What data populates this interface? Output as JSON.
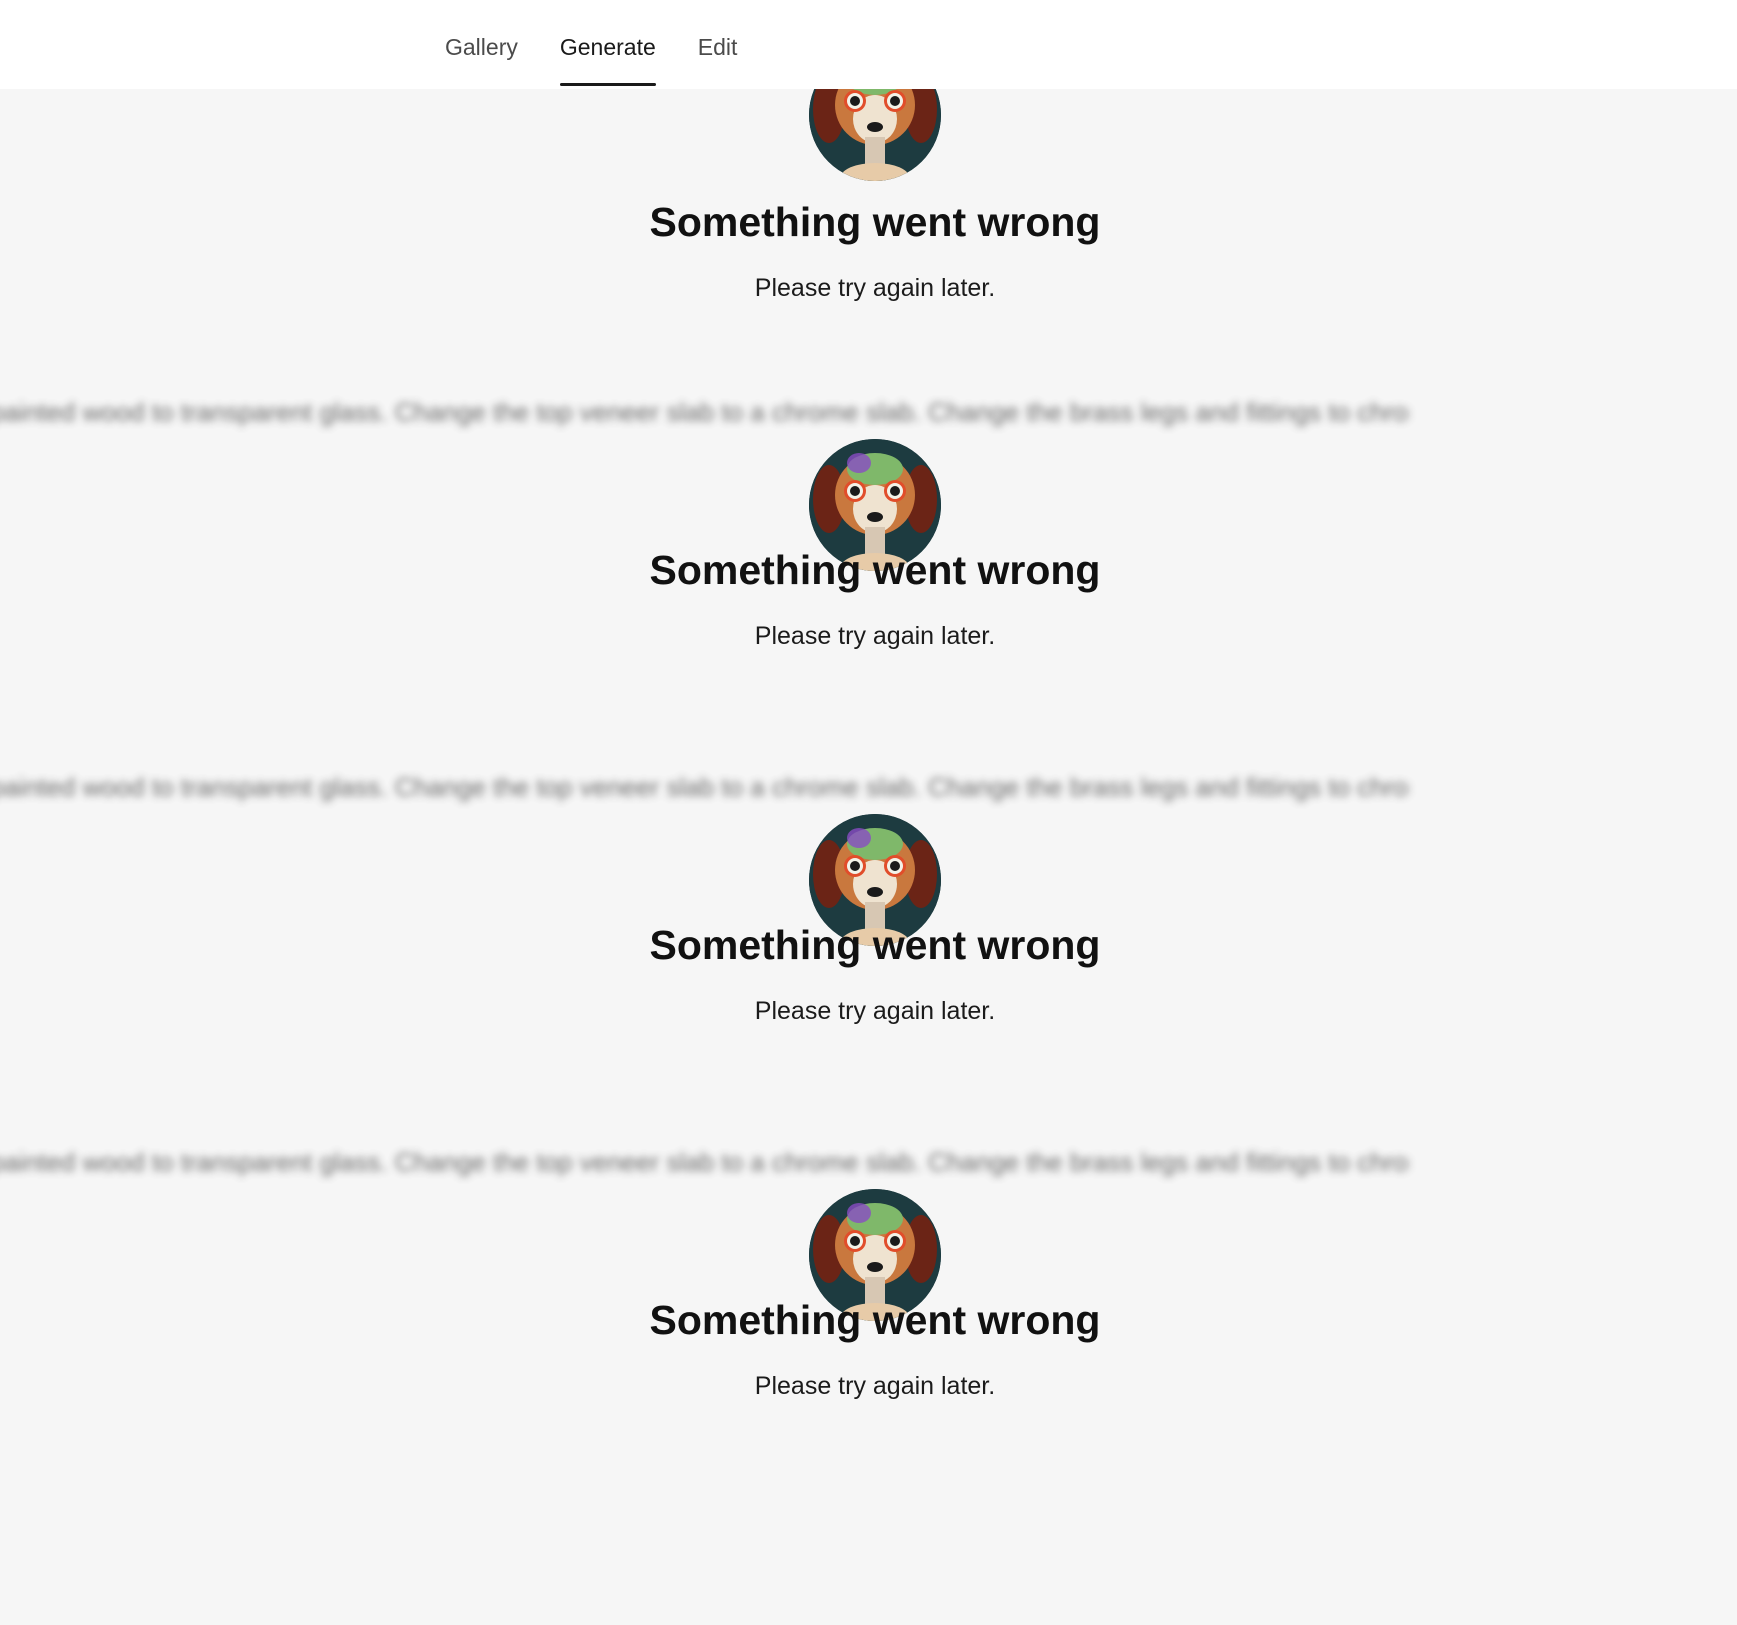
{
  "nav": {
    "tabs": [
      {
        "label": "Gallery",
        "active": false
      },
      {
        "label": "Generate",
        "active": true
      },
      {
        "label": "Edit",
        "active": false
      }
    ]
  },
  "blocks": [
    {
      "prompt": "",
      "title": "Something went wrong",
      "message": "Please try again later."
    },
    {
      "prompt": "painted wood to transparent glass. Change the top veneer slab to a chrome slab. Change the brass legs and fittings to chrome",
      "title": "Something went wrong",
      "message": "Please try again later."
    },
    {
      "prompt": "painted wood to transparent glass. Change the top veneer slab to a chrome slab. Change the brass legs and fittings to chrome",
      "title": "Something went wrong",
      "message": "Please try again later."
    },
    {
      "prompt": "painted wood to transparent glass. Change the top veneer slab to a chrome slab. Change the brass legs and fittings to chrome",
      "title": "Something went wrong",
      "message": "Please try again later."
    }
  ],
  "colors": {
    "background": "#f6f6f6",
    "header": "#ffffff",
    "active_tab_underline": "#1a1a1a"
  }
}
